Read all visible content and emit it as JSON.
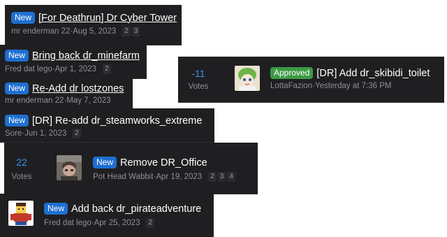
{
  "badges": {
    "new": "New",
    "approved": "Approved"
  },
  "votes_label": "Votes",
  "threads": [
    {
      "title": "[For Deathrun] Dr Cyber Tower",
      "author": "mr enderman 22",
      "date": "Aug 5, 2023",
      "pages": [
        "2",
        "3"
      ]
    },
    {
      "title": "Bring back dr_minefarm",
      "author": "Fred dat lego",
      "date": "Apr 1, 2023",
      "pages": [
        "2"
      ]
    },
    {
      "title": "Re-Add dr lostzones",
      "author": "mr enderman 22",
      "date": "May 7, 2023",
      "pages": []
    },
    {
      "title": "[DR] Re-add dr_steamworks_extreme",
      "author": "Sore",
      "date": "Jun 1, 2023",
      "pages": [
        "2"
      ]
    },
    {
      "votes": "22",
      "title": "Remove DR_Office",
      "author": "Pot Head Wabbit",
      "date": "Apr 19, 2023",
      "pages": [
        "2",
        "3",
        "4"
      ],
      "avatar": "avatar-photo"
    },
    {
      "title": "Add back dr_pirateadventure",
      "author": "Fred dat lego",
      "date": "Apr 25, 2023",
      "pages": [
        "2"
      ],
      "avatar": "lego-avatar"
    },
    {
      "votes": "-11",
      "title": "[DR] Add dr_skibidi_toilet",
      "author": "LottaFazion",
      "date": "Yesterday at 7:36 PM",
      "pages": [],
      "avatar": "anime-avatar"
    }
  ],
  "separator": " · ",
  "colors": {
    "card_bg": "#1f1f22",
    "new_badge": "#1e6fd1",
    "approved_badge": "#3d9a45",
    "vote_number": "#3d8fe8",
    "meta_text": "#8e8e96"
  }
}
